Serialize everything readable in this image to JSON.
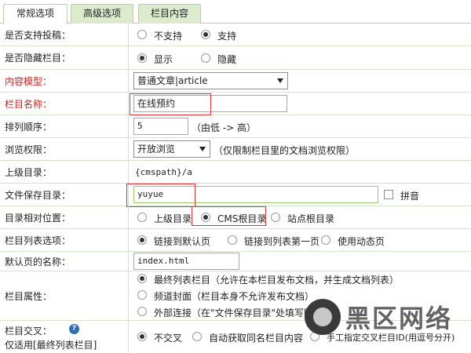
{
  "tabs": [
    {
      "label": "常规选项",
      "active": true
    },
    {
      "label": "高级选项",
      "active": false
    },
    {
      "label": "栏目内容",
      "active": false
    }
  ],
  "rows": {
    "submit": {
      "label": "是否支持投稿：",
      "opt1": "不支持",
      "opt2": "支持",
      "selected": "支持"
    },
    "hidden": {
      "label": "是否隐藏栏目：",
      "opt1": "显示",
      "opt2": "隐藏",
      "selected": "显示"
    },
    "model": {
      "label": "内容模型：",
      "value": "普通文章|article"
    },
    "name": {
      "label": "栏目名称：",
      "value": "在线预约"
    },
    "order": {
      "label": "排列顺序：",
      "value": "5",
      "hint": "（由低 -> 高）"
    },
    "perm": {
      "label": "浏览权限：",
      "value": "开放浏览",
      "hint": "（仅限制栏目里的文档浏览权限）"
    },
    "parent": {
      "label": "上级目录：",
      "value": "{cmspath}/a"
    },
    "savedir": {
      "label": "文件保存目录：",
      "value": "yuyue",
      "pinyin": "拼音"
    },
    "relpos": {
      "label": "目录相对位置：",
      "opt1": "上级目录",
      "opt2": "CMS根目录",
      "opt3": "站点根目录",
      "selected": "CMS根目录"
    },
    "listopt": {
      "label": "栏目列表选项：",
      "opt1": "链接到默认页",
      "opt2": "链接到列表第一页",
      "opt3": "使用动态页",
      "selected": "链接到默认页"
    },
    "defpage": {
      "label": "默认页的名称：",
      "value": "index.html"
    },
    "attr": {
      "label": "栏目属性：",
      "opt1": "最终列表栏目（允许在本栏目发布文档，并生成文档列表）",
      "opt2": "频道封面（栏目本身不允许发布文档）",
      "opt3": "外部连接（在\"文件保存目录\"处填写网址）",
      "selected": "opt1"
    },
    "cross": {
      "label": "栏目交叉：",
      "sublabel": "仅适用[最终列表栏目]",
      "help": "?",
      "opt1": "不交叉",
      "opt2": "自动获取同名栏目内容",
      "opt3": "手工指定交叉栏目ID(用逗号分开)",
      "selected": "不交叉"
    }
  },
  "watermark": {
    "text": "黑区网络"
  }
}
